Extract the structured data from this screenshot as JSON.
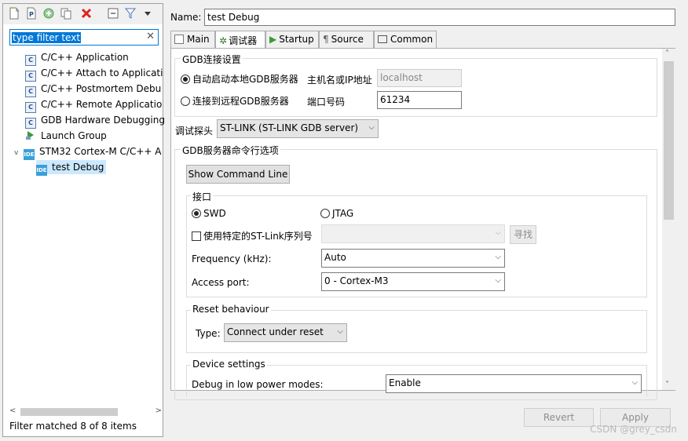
{
  "left": {
    "toolbar_icons": [
      "new-config-icon",
      "new-prototype-icon",
      "export-icon",
      "duplicate-icon",
      "delete-icon",
      "collapse-all-icon",
      "filter-icon",
      "view-menu-icon"
    ],
    "filter_placeholder": "type filter text",
    "tree": [
      {
        "label": "C/C++ Application",
        "icon": "c-icon"
      },
      {
        "label": "C/C++ Attach to Applicati",
        "icon": "c-icon"
      },
      {
        "label": "C/C++ Postmortem Debu",
        "icon": "c-icon"
      },
      {
        "label": "C/C++ Remote Applicatio",
        "icon": "c-icon"
      },
      {
        "label": "GDB Hardware Debugging",
        "icon": "c-icon"
      },
      {
        "label": "Launch Group",
        "icon": "launch-group-icon"
      },
      {
        "label": "STM32 Cortex-M C/C++ A",
        "icon": "ide-icon"
      },
      {
        "label": "test Debug",
        "icon": "ide-icon"
      }
    ],
    "status": "Filter matched 8 of 8 items"
  },
  "name_label": "Name:",
  "name_value": "test Debug",
  "tabs": [
    {
      "label": "Main",
      "icon": "main-tab-icon"
    },
    {
      "label": "调试器",
      "icon": "debugger-tab-icon"
    },
    {
      "label": "Startup",
      "icon": "startup-tab-icon"
    },
    {
      "label": "Source",
      "icon": "source-tab-icon"
    },
    {
      "label": "Common",
      "icon": "common-tab-icon"
    }
  ],
  "gdb_conn": {
    "title": "GDB连接设置",
    "auto_local": "自动启动本地GDB服务器",
    "host_label": "主机名或IP地址",
    "host_value": "localhost",
    "remote": "连接到远程GDB服务器",
    "port_label": "端口号码",
    "port_value": "61234"
  },
  "probe": {
    "label": "调试探头",
    "value": "ST-LINK (ST-LINK GDB server)"
  },
  "gdb_server_opts": {
    "title": "GDB服务器命令行选项",
    "show_cmd": "Show Command Line"
  },
  "interface": {
    "title": "接口",
    "swd": "SWD",
    "jtag": "JTAG",
    "use_serial": "使用特定的ST-Link序列号",
    "find": "寻找",
    "freq_label": "Frequency (kHz):",
    "freq_value": "Auto",
    "access_label": "Access port:",
    "access_value": "0 - Cortex-M3"
  },
  "reset": {
    "title": "Reset behaviour",
    "type_label": "Type:",
    "type_value": "Connect under reset"
  },
  "device": {
    "title": "Device settings",
    "lowpower_label": "Debug in low power modes:",
    "lowpower_value": "Enable"
  },
  "buttons": {
    "revert": "Revert",
    "apply": "Apply"
  },
  "watermark": "CSDN @grey_csdn"
}
